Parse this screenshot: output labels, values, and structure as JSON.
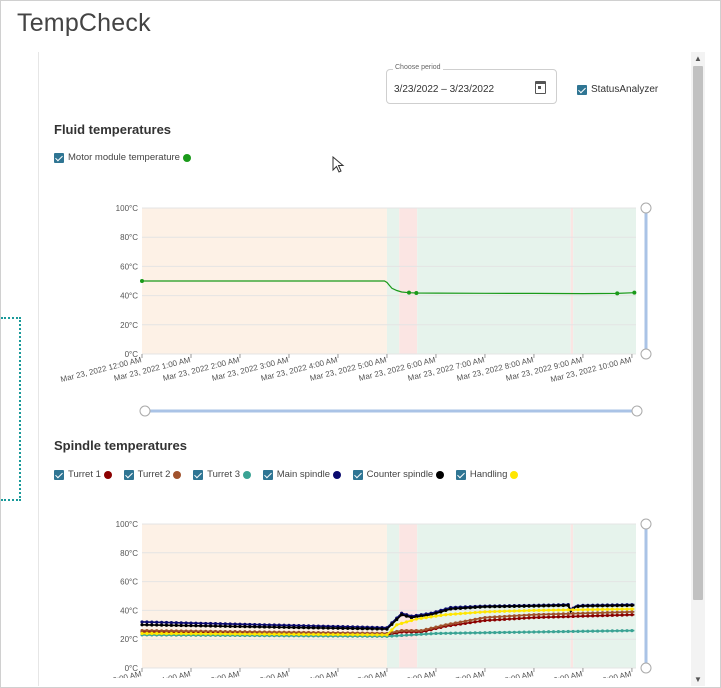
{
  "app": {
    "title": "TempCheck"
  },
  "period": {
    "label": "Choose period",
    "value": "3/23/2022 – 3/23/2022"
  },
  "status_analyzer": {
    "label": "StatusAnalyzer",
    "checked": true
  },
  "fluid": {
    "title": "Fluid temperatures",
    "legend": [
      {
        "label": "Motor module temperature",
        "color": "#1a9a1a"
      }
    ]
  },
  "spindle": {
    "title": "Spindle temperatures",
    "legend": [
      {
        "label": "Turret 1",
        "color": "#8b0000"
      },
      {
        "label": "Turret 2",
        "color": "#a0522d"
      },
      {
        "label": "Turret 3",
        "color": "#3aa394"
      },
      {
        "label": "Main spindle",
        "color": "#0a0a6e"
      },
      {
        "label": "Counter spindle",
        "color": "#000000"
      },
      {
        "label": "Handling",
        "color": "#ffe600"
      }
    ]
  },
  "axes": {
    "y_ticks": [
      "0°C",
      "20°C",
      "40°C",
      "60°C",
      "80°C",
      "100°C"
    ],
    "x_ticks": [
      "Mar 23, 2022 12:00 AM",
      "Mar 23, 2022 1:00 AM",
      "Mar 23, 2022 2:00 AM",
      "Mar 23, 2022 3:00 AM",
      "Mar 23, 2022 4:00 AM",
      "Mar 23, 2022 5:00 AM",
      "Mar 23, 2022 6:00 AM",
      "Mar 23, 2022 7:00 AM",
      "Mar 23, 2022 8:00 AM",
      "Mar 23, 2022 9:00 AM",
      "Mar 23, 2022 10:00 AM"
    ]
  },
  "chart_data": [
    {
      "type": "line",
      "title": "Fluid temperatures",
      "ylim": [
        0,
        100
      ],
      "xlim": [
        "0:00",
        "10:05"
      ],
      "y_unit": "°C",
      "background_bands": [
        {
          "from": "0:00",
          "to": "5:00",
          "color": "#fdf1e6"
        },
        {
          "from": "5:00",
          "to": "5:15",
          "color": "#e6f3ec"
        },
        {
          "from": "5:15",
          "to": "5:37",
          "color": "#fbe5e3"
        },
        {
          "from": "5:37",
          "to": "8:45",
          "color": "#e6f3ec"
        },
        {
          "from": "8:45",
          "to": "8:48",
          "color": "#fbe5e3"
        },
        {
          "from": "8:48",
          "to": "10:05",
          "color": "#e6f3ec"
        }
      ],
      "series": [
        {
          "name": "Motor module temperature",
          "color": "#1a9a1a",
          "x": [
            0,
            4.95,
            5.0,
            5.05,
            5.1,
            5.2,
            5.3,
            5.45,
            5.6,
            6.0,
            7.0,
            8.0,
            9.0,
            9.7,
            10.05
          ],
          "values": [
            50,
            50,
            49,
            47,
            45,
            43.5,
            42.5,
            42,
            41.8,
            41.7,
            41.6,
            41.5,
            41.4,
            41.5,
            42
          ],
          "markers_x": [
            0,
            5.45,
            5.6,
            9.7,
            10.05
          ]
        }
      ]
    },
    {
      "type": "line",
      "title": "Spindle temperatures",
      "ylim": [
        0,
        100
      ],
      "xlim": [
        "0:00",
        "10:05"
      ],
      "y_unit": "°C",
      "background_bands": [
        {
          "from": "0:00",
          "to": "5:00",
          "color": "#fdf1e6"
        },
        {
          "from": "5:00",
          "to": "5:15",
          "color": "#e6f3ec"
        },
        {
          "from": "5:15",
          "to": "5:37",
          "color": "#fbe5e3"
        },
        {
          "from": "5:37",
          "to": "8:45",
          "color": "#e6f3ec"
        },
        {
          "from": "8:45",
          "to": "8:48",
          "color": "#fbe5e3"
        },
        {
          "from": "8:48",
          "to": "10:05",
          "color": "#e6f3ec"
        }
      ],
      "series": [
        {
          "name": "Turret 1",
          "color": "#8b0000",
          "x": [
            0,
            5.0,
            5.3,
            5.7,
            6.2,
            7.0,
            8.0,
            9.0,
            10.05
          ],
          "values": [
            25,
            23,
            25,
            25,
            29,
            33,
            35,
            36,
            37
          ]
        },
        {
          "name": "Turret 2",
          "color": "#a0522d",
          "x": [
            0,
            5.0,
            5.3,
            5.7,
            6.2,
            7.0,
            8.0,
            9.0,
            10.05
          ],
          "values": [
            26,
            24,
            26,
            26,
            30,
            35,
            37,
            38,
            39
          ]
        },
        {
          "name": "Turret 3",
          "color": "#3aa394",
          "x": [
            0,
            5.0,
            5.5,
            6.0,
            7.0,
            8.0,
            9.0,
            10.05
          ],
          "values": [
            23,
            22,
            23,
            24,
            24.5,
            25,
            25.5,
            26
          ]
        },
        {
          "name": "Main spindle",
          "color": "#0a0a6e",
          "x": [
            0,
            5.0,
            5.15,
            5.3,
            5.5,
            5.9,
            6.3,
            7.0,
            8.0,
            8.7,
            8.75,
            8.85,
            9.0,
            10.05
          ],
          "values": [
            32,
            28,
            33,
            38,
            36,
            38,
            42,
            43,
            43.5,
            44,
            40,
            43,
            43.5,
            44
          ]
        },
        {
          "name": "Counter spindle",
          "color": "#000000",
          "x": [
            0,
            5.0,
            5.15,
            5.3,
            5.5,
            5.9,
            6.3,
            7.0,
            8.0,
            8.7,
            8.75,
            8.85,
            9.0,
            10.05
          ],
          "values": [
            30,
            27,
            32,
            37,
            35,
            37,
            41,
            42.5,
            43,
            43.5,
            39,
            42.5,
            43,
            43.5
          ]
        },
        {
          "name": "Handling",
          "color": "#ffe600",
          "x": [
            0,
            5.0,
            5.2,
            5.6,
            6.2,
            7.0,
            8.0,
            9.0,
            10.05
          ],
          "values": [
            24,
            23,
            30,
            34,
            37,
            39,
            40,
            40.5,
            41
          ]
        }
      ]
    }
  ]
}
